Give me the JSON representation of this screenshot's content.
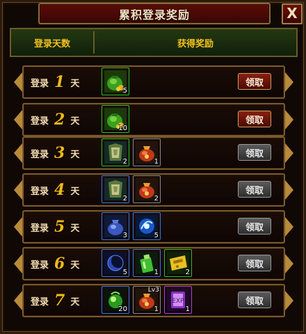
{
  "window": {
    "title": "累积登录奖励",
    "close_label": "X"
  },
  "header": {
    "days_label": "登录天数",
    "reward_label": "获得奖励"
  },
  "rows": [
    {
      "prefix": "登录",
      "day": "1",
      "suffix": "天",
      "claim": "领取",
      "claim_state": "active",
      "items": [
        {
          "icon": "money-bag-icon",
          "rarity": "green",
          "qty": "5",
          "level": ""
        }
      ]
    },
    {
      "prefix": "登录",
      "day": "2",
      "suffix": "天",
      "claim": "领取",
      "claim_state": "active",
      "items": [
        {
          "icon": "money-bag-icon",
          "rarity": "green",
          "qty": "10",
          "level": ""
        }
      ]
    },
    {
      "prefix": "登录",
      "day": "3",
      "suffix": "天",
      "claim": "领取",
      "claim_state": "disabled",
      "items": [
        {
          "icon": "armor-icon",
          "rarity": "green",
          "qty": "2",
          "level": ""
        },
        {
          "icon": "red-pouch-icon",
          "rarity": "grey",
          "qty": "1",
          "level": ""
        }
      ]
    },
    {
      "prefix": "登录",
      "day": "4",
      "suffix": "天",
      "claim": "领取",
      "claim_state": "disabled",
      "items": [
        {
          "icon": "armor-icon",
          "rarity": "blue",
          "qty": "2",
          "level": ""
        },
        {
          "icon": "red-pouch-icon",
          "rarity": "grey",
          "qty": "2",
          "level": ""
        }
      ]
    },
    {
      "prefix": "登录",
      "day": "5",
      "suffix": "天",
      "claim": "领取",
      "claim_state": "disabled",
      "items": [
        {
          "icon": "blue-pouch-icon",
          "rarity": "blue",
          "qty": "3",
          "level": ""
        },
        {
          "icon": "energy-orb-icon",
          "rarity": "blue",
          "qty": "5",
          "level": ""
        }
      ]
    },
    {
      "prefix": "登录",
      "day": "6",
      "suffix": "天",
      "claim": "领取",
      "claim_state": "disabled",
      "items": [
        {
          "icon": "crescent-moon-icon",
          "rarity": "blue",
          "qty": "5",
          "level": ""
        },
        {
          "icon": "potion-bottle-icon",
          "rarity": "blue",
          "qty": "1",
          "level": ""
        },
        {
          "icon": "golden-ticket-icon",
          "rarity": "green",
          "qty": "2",
          "level": ""
        }
      ]
    },
    {
      "prefix": "登录",
      "day": "7",
      "suffix": "天",
      "claim": "领取",
      "claim_state": "disabled",
      "items": [
        {
          "icon": "green-orb-icon",
          "rarity": "blue",
          "qty": "20",
          "level": ""
        },
        {
          "icon": "red-pouch-icon",
          "rarity": "grey",
          "qty": "1",
          "level": "Lv3"
        },
        {
          "icon": "exp-card-icon",
          "rarity": "purple",
          "qty": "1",
          "level": ""
        }
      ]
    }
  ]
}
